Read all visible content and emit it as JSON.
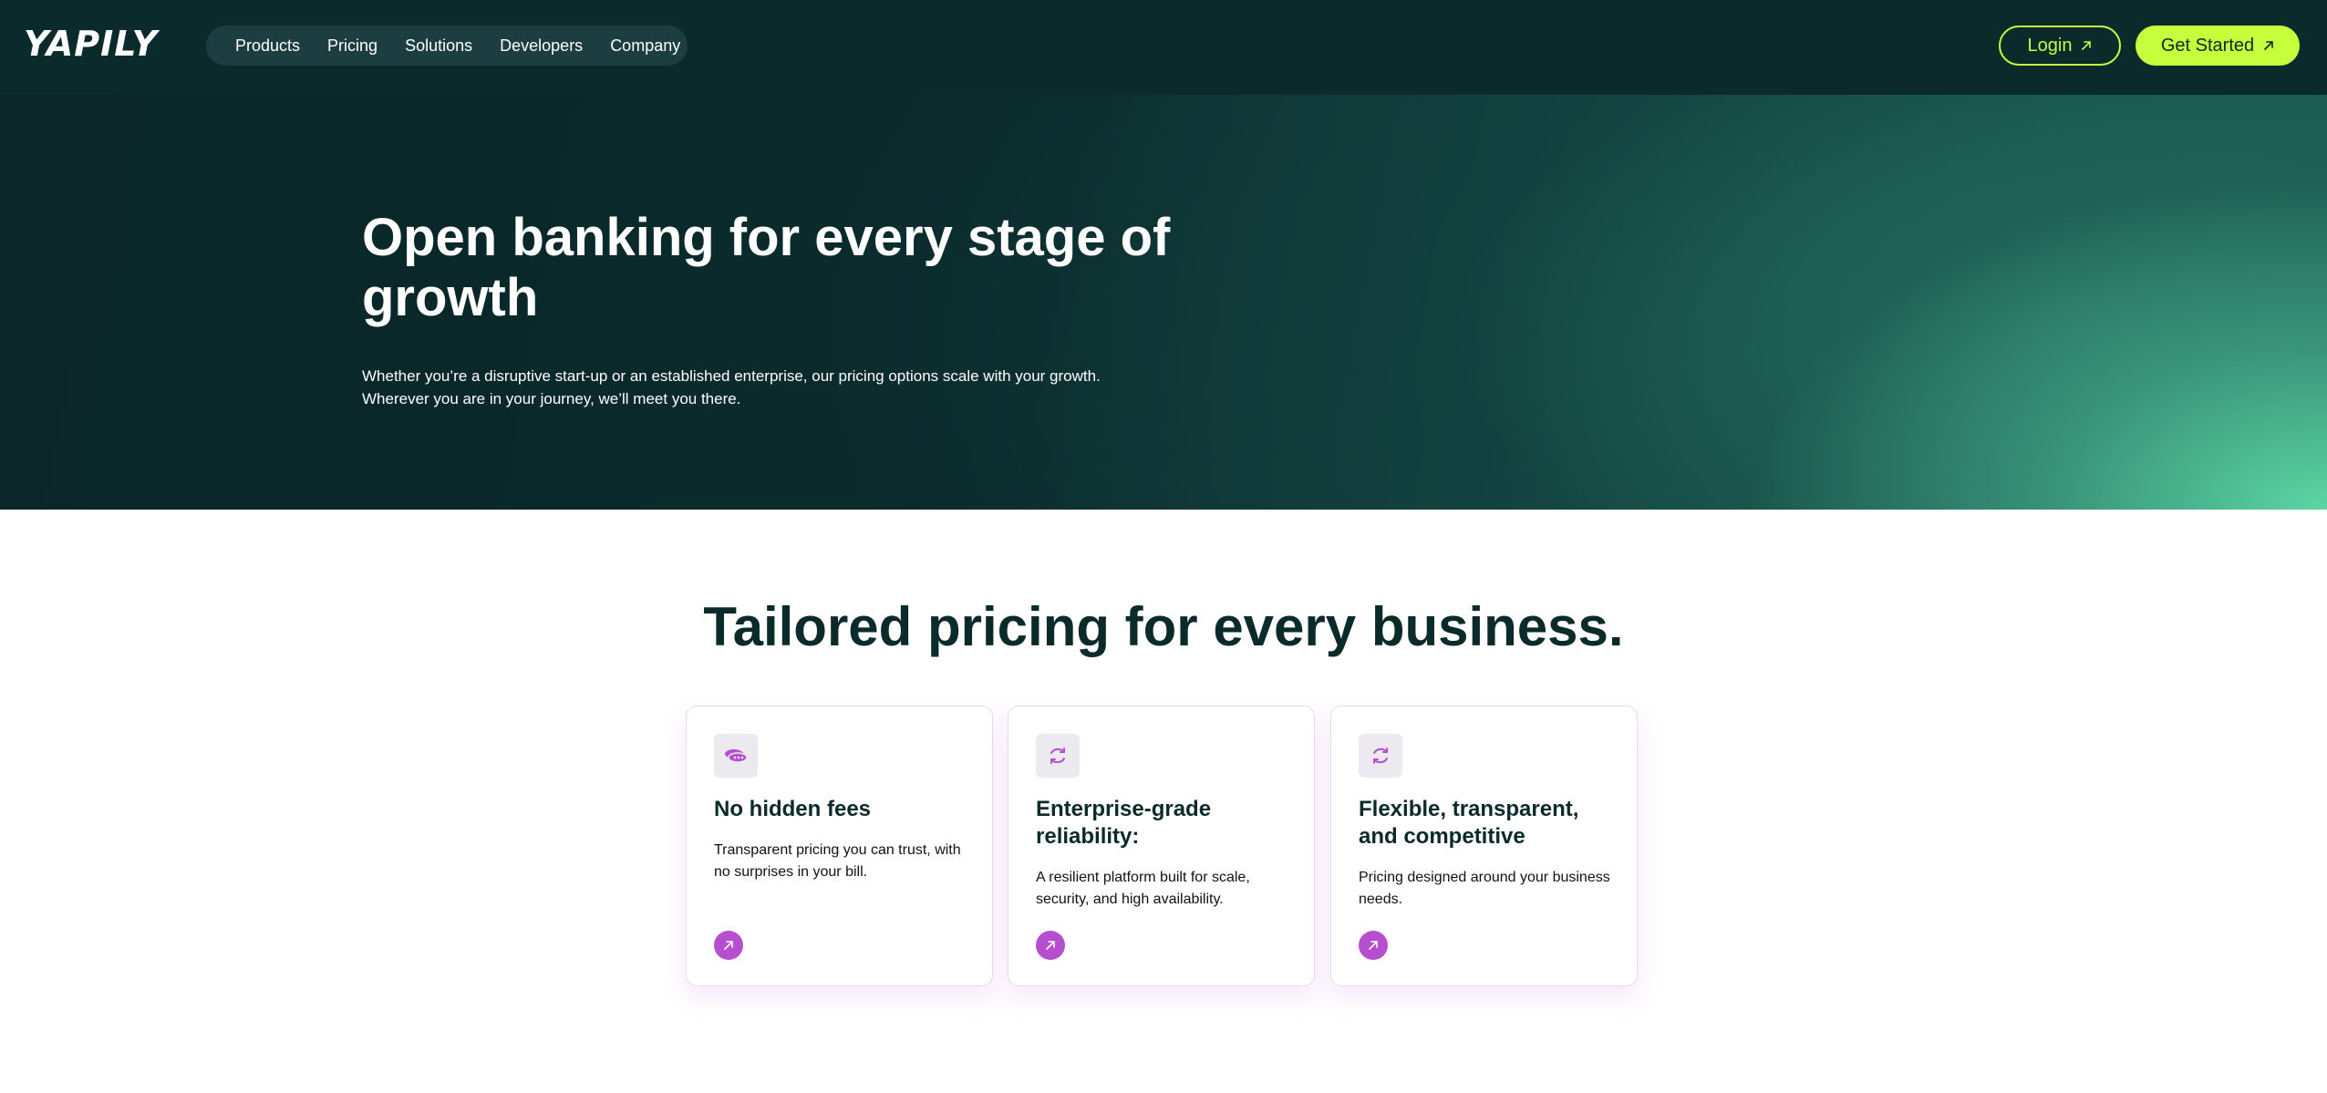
{
  "brand": {
    "logo_text": "YAPILY"
  },
  "nav": {
    "items": [
      {
        "label": "Products"
      },
      {
        "label": "Pricing"
      },
      {
        "label": "Solutions"
      },
      {
        "label": "Developers"
      },
      {
        "label": "Company"
      }
    ]
  },
  "header_actions": {
    "login_label": "Login",
    "get_started_label": "Get Started"
  },
  "hero": {
    "title": "Open banking for every stage of growth",
    "subtitle_line1": "Whether you’re a disruptive start-up or an established enterprise, our pricing options scale with your growth.",
    "subtitle_line2": "Wherever you are in your journey, we’ll meet you there."
  },
  "pricing_section": {
    "title": "Tailored pricing for every business.",
    "cards": [
      {
        "icon": "coins-icon",
        "title": "No hidden fees",
        "text": "Transparent pricing you can trust, with no surprises in your bill."
      },
      {
        "icon": "refresh-icon",
        "title": "Enterprise-grade reliability:",
        "text": "A resilient platform built for scale, security, and high availability."
      },
      {
        "icon": "refresh-icon",
        "title": "Flexible, transparent, and competitive",
        "text": "Pricing designed around your business needs."
      }
    ]
  },
  "colors": {
    "header_bg": "#0b2a2c",
    "accent_lime": "#c6ff3c",
    "accent_purple": "#b54fd0",
    "hero_gradient_end": "#5cd6a4"
  }
}
